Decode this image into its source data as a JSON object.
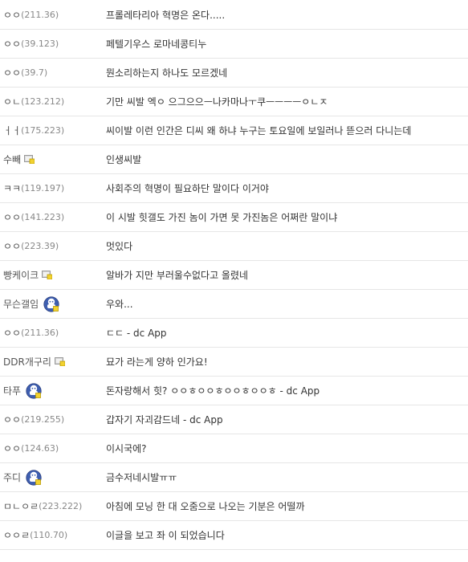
{
  "comments": [
    {
      "name": "ㅇㅇ",
      "ip": "(211.36)",
      "text": "프롤레타리아 혁명은 온다.....",
      "icon": ""
    },
    {
      "name": "ㅇㅇ",
      "ip": "(39.123)",
      "text": "페텔기우스 로마네콩티누",
      "icon": ""
    },
    {
      "name": "ㅇㅇ",
      "ip": "(39.7)",
      "text": "뭔소리하는지 하나도 모르겠네",
      "icon": ""
    },
    {
      "name": "ㅇㄴ",
      "ip": "(123.212)",
      "text": "기만 씨발 엑ㅇ 으그으으ㅡ나카마나ㅜ쿠ㅡㅡㅡㅡㅇㄴㅈ",
      "icon": ""
    },
    {
      "name": "ㅓㅓ",
      "ip": "(175.223)",
      "text": "씨이발 이런 인간은 디씨 왜 하냐 누구는 토요일에 보일러나 뜯으러 다니는데",
      "icon": ""
    },
    {
      "name": "수빼",
      "ip": "",
      "text": "인생씨발",
      "icon": "fixed-nick-icon"
    },
    {
      "name": "ㅋㅋ",
      "ip": "(119.197)",
      "text": "사회주의 혁명이 필요하단 말이다 이거야",
      "icon": ""
    },
    {
      "name": "ㅇㅇ",
      "ip": "(141.223)",
      "text": "이 시발 힛갤도 가진 놈이 가면 못 가진놈은 어쩌란 말이냐",
      "icon": ""
    },
    {
      "name": "ㅇㅇ",
      "ip": "(223.39)",
      "text": "멋있다",
      "icon": ""
    },
    {
      "name": "빵케이크",
      "ip": "",
      "text": "알바가 지만 부러울수없다고 올렸네",
      "icon": "fixed-nick-icon"
    },
    {
      "name": "무슨갤임",
      "ip": "",
      "text": "우와...",
      "icon": "gallog-icon"
    },
    {
      "name": "ㅇㅇ",
      "ip": "(211.36)",
      "text": "ㄷㄷ - dc App",
      "icon": ""
    },
    {
      "name": "DDR개구리",
      "ip": "",
      "text": "묘가 라는게 양하 인가요!",
      "icon": "fixed-nick-icon"
    },
    {
      "name": "타푸",
      "ip": "",
      "text": "돈자랑해서 힛? ㅇㅇㅎㅇㅇㅎㅇㅇㅎㅇㅇㅎ - dc App",
      "icon": "gallog-icon"
    },
    {
      "name": "ㅇㅇ",
      "ip": "(219.255)",
      "text": "갑자기 자괴감드네 - dc App",
      "icon": ""
    },
    {
      "name": "ㅇㅇ",
      "ip": "(124.63)",
      "text": "이시국에?",
      "icon": ""
    },
    {
      "name": "주디",
      "ip": "",
      "text": "금수저네시발ㅠㅠ",
      "icon": "gallog-icon"
    },
    {
      "name": "ㅁㄴㅇㄹ",
      "ip": "(223.222)",
      "text": "아침에 모닝 한 대 오줌으로 나오는 기분은 어떨까",
      "icon": ""
    },
    {
      "name": "ㅇㅇㄹ",
      "ip": "(110.70)",
      "text": "이글을 보고 좌   이 되었습니다",
      "icon": ""
    }
  ]
}
